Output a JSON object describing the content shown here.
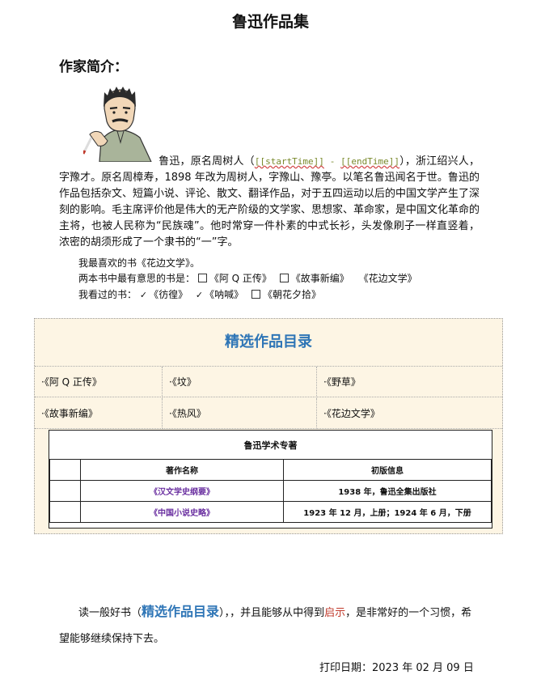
{
  "title": "鲁迅作品集",
  "subhead": "作家简介：",
  "bio": {
    "lead": "鲁迅，原名周树人（",
    "start_tpl": "[[startTime]]",
    "dash": " - ",
    "end_tpl": "[[endTime]]",
    "rest": "），浙江绍兴人，字豫才。原名周樟寿，1898 年改为周树人，字豫山、豫亭。以笔名鲁迅闻名于世。鲁迅的作品包括杂文、短篇小说、评论、散文、翻译作品，对于五四运动以后的中国文学产生了深刻的影响。毛主席评价他是伟大的无产阶级的文学家、思想家、革命家，是中国文化革命的主将，也被人民称为“民族魂”。他时常穿一件朴素的中式长衫，头发像刷子一样直竖着，浓密的胡须形成了一个隶书的“一”字。"
  },
  "favorite": "我最喜欢的书《花边文学》。",
  "meaningful": {
    "label": "两本书中最有意思的书是：",
    "options": [
      "《阿 Q 正传》",
      "《故事新编》",
      "《花边文学》"
    ]
  },
  "read": {
    "label": "我看过的书：",
    "options": [
      "《彷徨》",
      "《呐喊》",
      "《朝花夕拾》"
    ],
    "checked": [
      true,
      true,
      false
    ]
  },
  "catalog": {
    "title": "精选作品目录",
    "rows": [
      [
        "·《阿 Q 正传》",
        "·《坟》",
        "·《野草》"
      ],
      [
        "·《故事新编》",
        "·《热风》",
        "·《花边文学》"
      ]
    ],
    "table": {
      "caption": "鲁迅学术专著",
      "headers": [
        "著作名称",
        "初版信息"
      ],
      "rows": [
        [
          "《汉文学史纲要》",
          "1938 年，鲁迅全集出版社"
        ],
        [
          "《中国小说史略》",
          "1923 年 12 月，上册；1924 年 6 月，下册"
        ]
      ]
    }
  },
  "closing": {
    "pre": "读一般好书",
    "link": "精选作品目录",
    "mid": "，并且能够从中得到",
    "red": "启示",
    "post": "，是非常好的一个习惯，希望能够继续保持下去。"
  },
  "print_date": "打印日期：2023 年 02 月 09 日"
}
